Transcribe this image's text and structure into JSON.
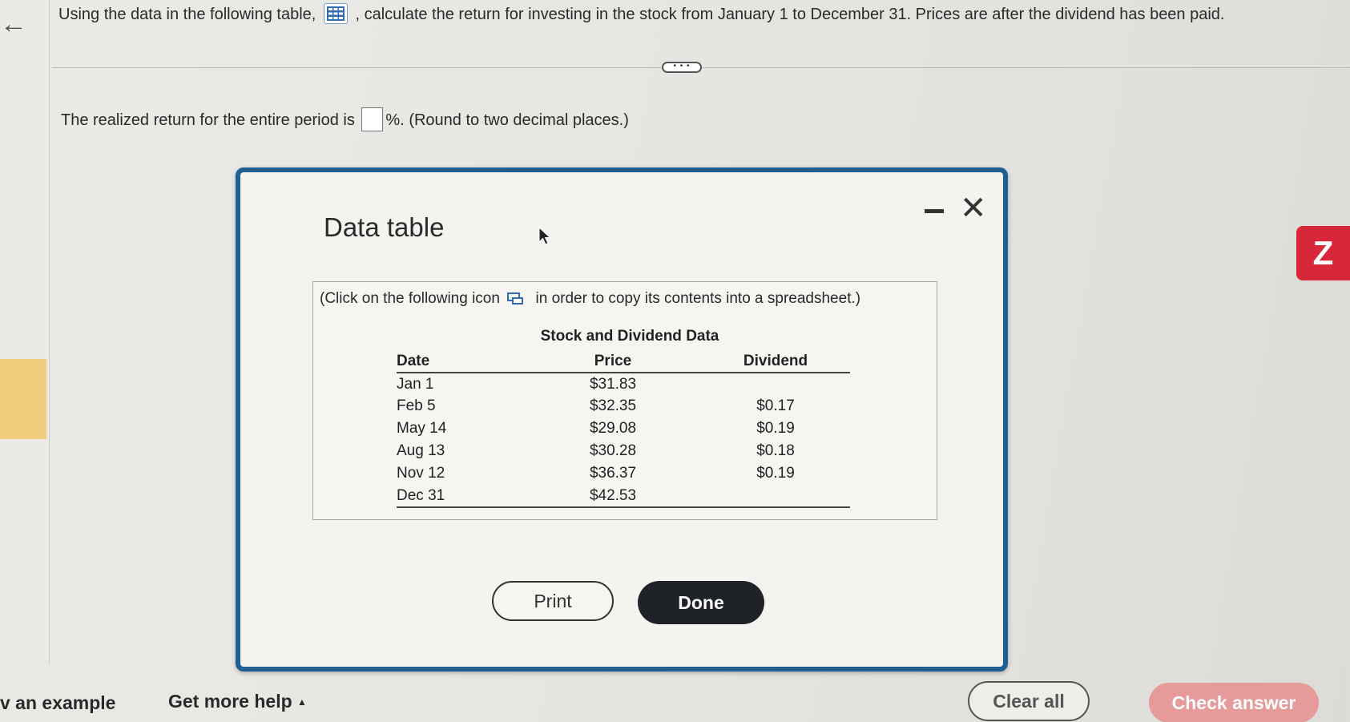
{
  "question": {
    "before_icon": "Using the data in the following table,",
    "after_icon": ", calculate the return for investing in the stock from January 1 to December 31. Prices are after the dividend has been paid."
  },
  "answer": {
    "before_box": "The realized return for the entire period is",
    "after_box": "%. (Round to two decimal places.)",
    "value": ""
  },
  "modal": {
    "title": "Data table",
    "note_before_icon": "(Click on the following icon",
    "note_after_icon": "in order to copy its contents into a spreadsheet.)",
    "table_title": "Stock and Dividend Data",
    "columns": [
      "Date",
      "Price",
      "Dividend"
    ],
    "rows": [
      {
        "date": "Jan 1",
        "price": "$31.83",
        "dividend": ""
      },
      {
        "date": "Feb 5",
        "price": "$32.35",
        "dividend": "$0.17"
      },
      {
        "date": "May 14",
        "price": "$29.08",
        "dividend": "$0.19"
      },
      {
        "date": "Aug 13",
        "price": "$30.28",
        "dividend": "$0.18"
      },
      {
        "date": "Nov 12",
        "price": "$36.37",
        "dividend": "$0.19"
      },
      {
        "date": "Dec 31",
        "price": "$42.53",
        "dividend": ""
      }
    ],
    "print_label": "Print",
    "done_label": "Done"
  },
  "footer": {
    "example_label": "v an example",
    "more_help_label": "Get more help",
    "clear_label": "Clear all",
    "check_label": "Check answer"
  },
  "badge_label": "Z",
  "more_label": "• • •",
  "icons": {
    "back": "arrow-left-icon",
    "table": "table-grid-icon",
    "copy": "copy-spreadsheet-icon",
    "minimize": "minimize-icon",
    "close": "close-icon",
    "cursor": "mouse-cursor-icon",
    "caret": "caret-up-icon"
  },
  "colors": {
    "modal_border": "#1f5f92",
    "done_bg": "#1f2328",
    "check_bg": "#e79a9a",
    "badge_bg": "#d7273b"
  }
}
